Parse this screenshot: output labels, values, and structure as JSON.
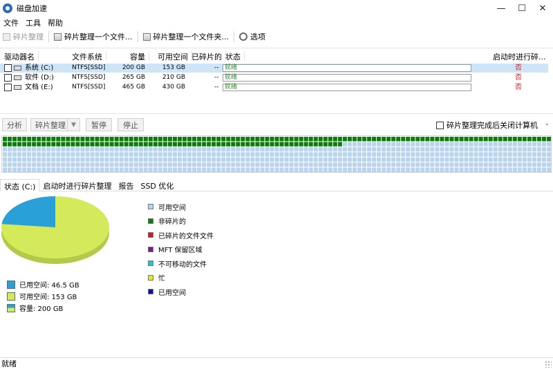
{
  "window": {
    "title": "磁盘加速",
    "minimize": "—",
    "maximize": "☐",
    "close": "✕"
  },
  "menu": [
    "文件",
    "工具",
    "帮助"
  ],
  "toolbar": {
    "defrag": "碎片整理",
    "defrag_files": "碎片整理一个文件...",
    "defrag_folder": "碎片整理一个文件夹...",
    "options": "选项"
  },
  "drive_table": {
    "headers": {
      "drive": "驱动器名",
      "fs": "文件系统",
      "capacity": "容量",
      "free": "可用空间",
      "fragmented": "已碎片的",
      "status": "状态",
      "boot": "启动时进行碎..."
    },
    "rows": [
      {
        "name": "系统 (C:)",
        "fs": "NTFS[SSD]",
        "capacity": "200 GB",
        "free": "153 GB",
        "fragmented": "--",
        "status": "就绪",
        "boot": "否"
      },
      {
        "name": "软件 (D:)",
        "fs": "NTFS[SSD]",
        "capacity": "265 GB",
        "free": "210 GB",
        "fragmented": "--",
        "status": "就绪",
        "boot": "否"
      },
      {
        "name": "文档 (E:)",
        "fs": "NTFS[SSD]",
        "capacity": "465 GB",
        "free": "430 GB",
        "fragmented": "--",
        "status": "就绪",
        "boot": "否"
      }
    ]
  },
  "actions": {
    "analyze": "分析",
    "defrag": "碎片整理",
    "pause": "暂停",
    "stop": "停止",
    "shutdown_label": "碎片整理完成后关闭计算机"
  },
  "cluster_map": {
    "colors": {
      "used": "#0b7d0b",
      "free": "#b8d4ee",
      "grid": "#ffffff"
    },
    "cols": 113,
    "rows": 7,
    "full_used_rows": 1,
    "second_row_used_fraction": 0.62
  },
  "tabs": [
    "状态 (C:)",
    "启动时进行碎片整理",
    "报告",
    "SSD 优化"
  ],
  "pie": {
    "used_color": "#2aa0d8",
    "free_color": "#d4ea5a",
    "used_fraction": 0.2325
  },
  "capacity_legend": [
    {
      "label": "已用空间: 46.5 GB",
      "color": "#2aa0d8"
    },
    {
      "label": "可用空间: 153 GB",
      "color": "#d4ea5a"
    },
    {
      "label": "容量: 200 GB",
      "color": "#d4ea5a"
    }
  ],
  "map_legend": [
    {
      "label": "可用空间",
      "color": "#b8d4ee"
    },
    {
      "label": "非碎片的",
      "color": "#0b7d0b"
    },
    {
      "label": "已碎片的文件文件",
      "color": "#d11a1a"
    },
    {
      "label": "MFT 保留区域",
      "color": "#7b1a8c"
    },
    {
      "label": "不可移动的文件",
      "color": "#20c8c8"
    },
    {
      "label": "忙",
      "color": "#e8e820"
    },
    {
      "label": "已用空间",
      "color": "#1010a8"
    }
  ],
  "statusbar": {
    "text": "就绪"
  }
}
